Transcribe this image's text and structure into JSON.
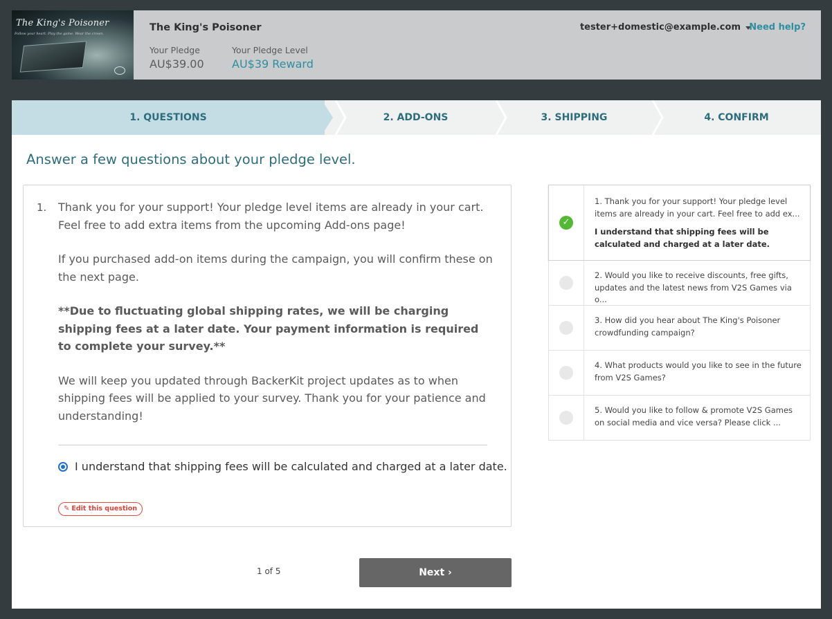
{
  "header": {
    "project_title": "The King's Poisoner",
    "logo_text": "The King's Poisoner",
    "logo_tagline": "Follow your heart. Play the game. Wear the crown.",
    "pledge_label": "Your Pledge",
    "pledge_amount": "AU$39.00",
    "pledge_level_label": "Your Pledge Level",
    "pledge_level": "AU$39 Reward",
    "user_email": "tester+domestic@example.com",
    "help_link": "Need help?"
  },
  "steps": [
    {
      "label": "1. QUESTIONS",
      "active": true
    },
    {
      "label": "2. ADD-ONS",
      "active": false
    },
    {
      "label": "3. SHIPPING",
      "active": false
    },
    {
      "label": "4. CONFIRM",
      "active": false
    }
  ],
  "page_heading": "Answer a few questions about your pledge level.",
  "question": {
    "number": "1.",
    "paragraphs": [
      "Thank you for your support! Your pledge level items are already in your cart. Feel free to add extra items from the upcoming Add-ons page!",
      "If you purchased add-on items during the campaign, you will confirm these on the next page.",
      "**Due to fluctuating global shipping rates, we will be charging shipping fees at a later date. Your payment information is required to complete your survey.**",
      "We will keep you updated through BackerKit project updates as to when shipping fees will be applied to your survey. Thank you for your patience and understanding!"
    ],
    "option_label": "I understand that shipping fees will be calculated and charged at a later date.",
    "option_selected": true,
    "edit_label": "Edit this question"
  },
  "question_list": [
    {
      "text": "1. Thank you for your support! Your pledge level items are already in your cart. Feel free to add ex...",
      "answer": "I understand that shipping fees will be calculated and charged at a later date.",
      "status": "answered"
    },
    {
      "text": "2. Would you like to receive discounts, free gifts, updates and the latest news from V2S Games via o...",
      "status": "pending"
    },
    {
      "text": "3. How did you hear about The King's Poisoner crowdfunding campaign?",
      "status": "pending"
    },
    {
      "text": "4. What products would you like to see in the future from V2S Games?",
      "status": "pending"
    },
    {
      "text": "5. Would you like to follow & promote V2S Games on social media and vice versa? Please click ...",
      "status": "pending"
    }
  ],
  "pager": {
    "text": "1 of 5"
  },
  "next_button": "Next ›",
  "colors": {
    "accent": "#2e8fa0",
    "step_active_bg": "#c4dde5",
    "next_button_bg": "#666666",
    "check_green": "#53b934",
    "edit_red": "#d8433a"
  }
}
